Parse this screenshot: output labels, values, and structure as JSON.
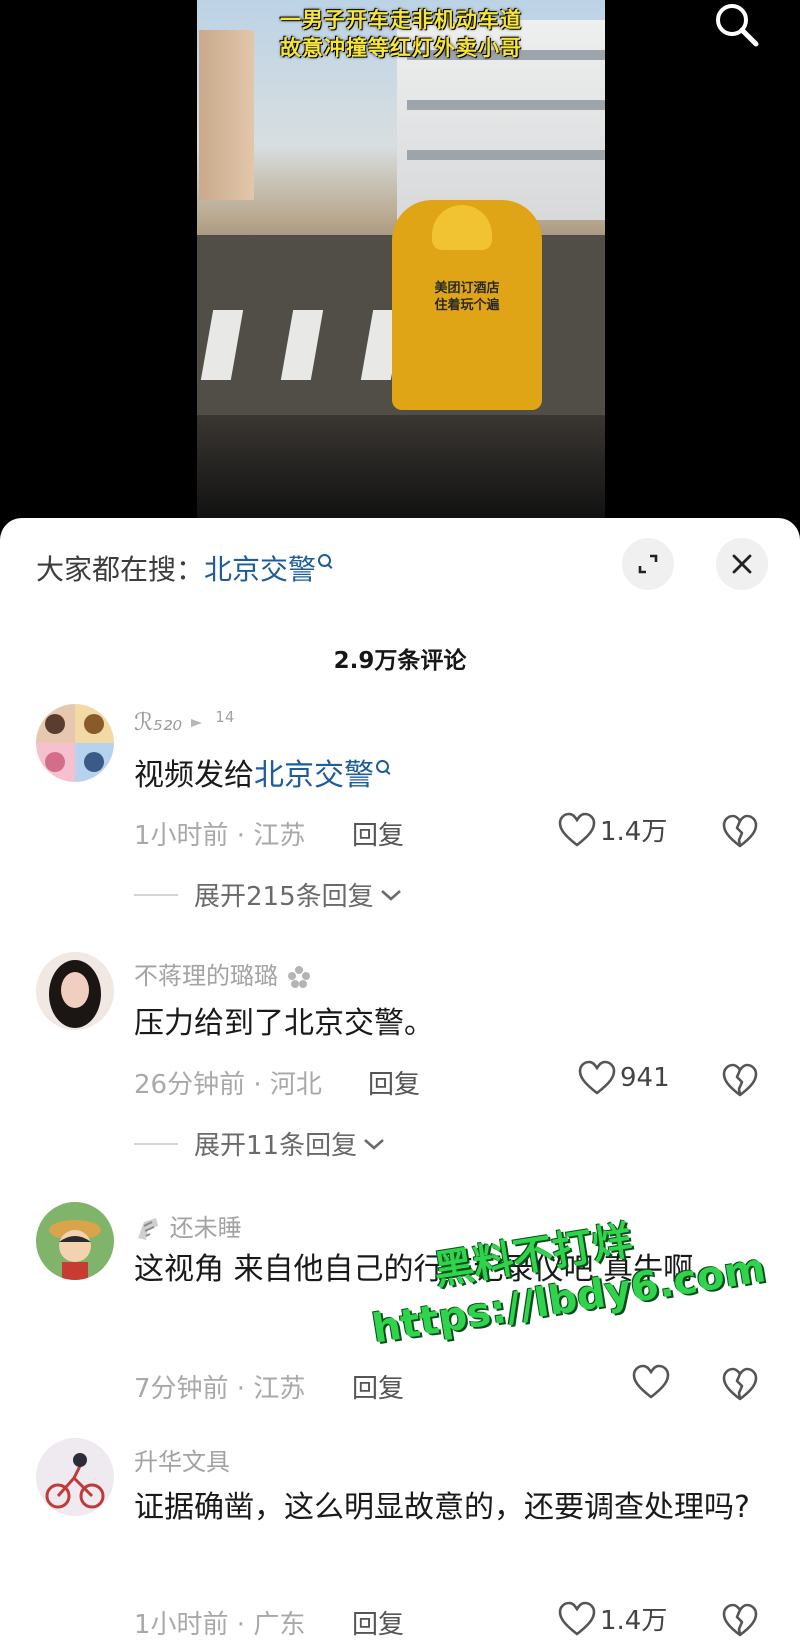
{
  "video": {
    "caption_line1": "一男子开车走非机动车道",
    "caption_line2": "故意冲撞等红灯外卖小哥",
    "jacket_text": "美团订酒店住着玩个遍"
  },
  "panel": {
    "hot_search_prefix": "大家都在搜：",
    "hot_search_keyword": "北京交警",
    "comment_count": "2.9万条评论"
  },
  "comments": [
    {
      "username": "ℛ₅₂₀",
      "badge": "14",
      "text_prefix": "视频发给",
      "text_link": "北京交警",
      "text": "",
      "time_location": "1小时前 · 江苏",
      "reply_label": "回复",
      "likes": "1.4万",
      "expand_label": "展开215条回复"
    },
    {
      "username": "不蒋理的璐璐",
      "text": "压力给到了北京交警。",
      "time_location": "26分钟前 · 河北",
      "reply_label": "回复",
      "likes": "941",
      "expand_label": "展开11条回复"
    },
    {
      "username": "还未睡",
      "text": "这视角  来自他自己的行车记录仪吧 真牛啊",
      "time_location": "7分钟前 · 江苏",
      "reply_label": "回复",
      "likes": ""
    },
    {
      "username": "升华文具",
      "text": "证据确凿，这么明显故意的，还要调查处理吗?",
      "time_location": "1小时前 · 广东",
      "reply_label": "回复",
      "likes": "1.4万"
    }
  ],
  "watermark": {
    "line1": "黑料不打烊",
    "line2": "https://lbdy6.com"
  },
  "colors": {
    "link": "#1e5c9a",
    "caption": "#f6e53a",
    "watermark": "#2fd34c"
  }
}
